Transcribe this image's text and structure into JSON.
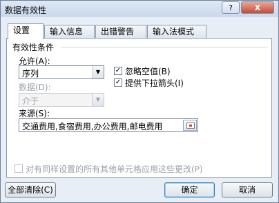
{
  "window": {
    "title": "数据有效性",
    "help_label": "?",
    "close_label": "X"
  },
  "tabs": [
    "设置",
    "输入信息",
    "出错警告",
    "输入法模式"
  ],
  "settings": {
    "section_title": "有效性条件",
    "allow_label": "允许(A):",
    "allow_value": "序列",
    "data_label": "数据(D):",
    "data_value": "介于",
    "ignore_blank_label": "忽略空值(B)",
    "ignore_blank_checked": true,
    "dropdown_label": "提供下拉箭头(I)",
    "dropdown_checked": true,
    "source_label": "来源(S):",
    "source_value": "交通费用,食宿费用,办公费用,邮电费用",
    "apply_all_label": "对有同样设置的所有其他单元格应用这些更改(P)",
    "apply_all_checked": false
  },
  "buttons": {
    "clear_all": "全部清除(C)",
    "ok": "确定",
    "cancel": "取消"
  },
  "icons": {
    "dropdown_arrow": "▼",
    "check": "✓",
    "range_picker": "range-selector-icon"
  }
}
